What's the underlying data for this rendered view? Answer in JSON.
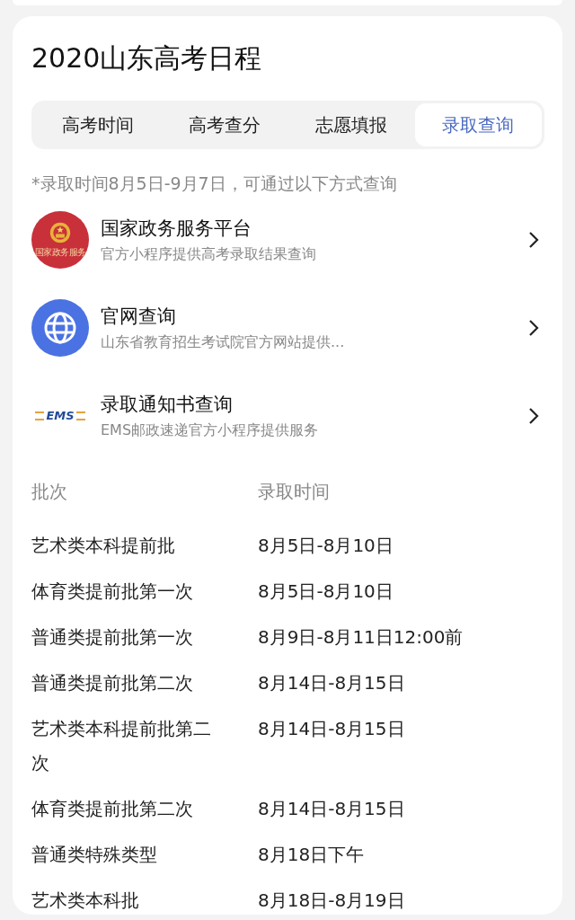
{
  "title": "2020山东高考日程",
  "tabs": [
    {
      "label": "高考时间",
      "selected": false
    },
    {
      "label": "高考查分",
      "selected": false
    },
    {
      "label": "志愿填报",
      "selected": false
    },
    {
      "label": "录取查询",
      "selected": true
    }
  ],
  "note": "*录取时间8月5日-9月7日，可通过以下方式查询",
  "services": [
    {
      "kind": "emblem",
      "logo_text": "国家政务服务",
      "title": "国家政务服务平台",
      "subtitle": "官方小程序提供高考录取结果查询"
    },
    {
      "kind": "globe",
      "title": "官网查询",
      "subtitle": "山东省教育招生考试院官方网站提供..."
    },
    {
      "kind": "ems",
      "logo_text": "EMS",
      "title": "录取通知书查询",
      "subtitle": "EMS邮政速递官方小程序提供服务"
    }
  ],
  "table": {
    "columns": [
      "批次",
      "录取时间"
    ],
    "rows": [
      [
        "艺术类本科提前批",
        "8月5日-8月10日"
      ],
      [
        "体育类提前批第一次",
        "8月5日-8月10日"
      ],
      [
        "普通类提前批第一次",
        "8月9日-8月11日12:00前"
      ],
      [
        "普通类提前批第二次",
        "8月14日-8月15日"
      ],
      [
        "艺术类本科提前批第二次",
        "8月14日-8月15日"
      ],
      [
        "体育类提前批第二次",
        "8月14日-8月15日"
      ],
      [
        "普通类特殊类型",
        "8月18日下午"
      ],
      [
        "艺术类本科批",
        "8月18日-8月19日"
      ]
    ]
  }
}
